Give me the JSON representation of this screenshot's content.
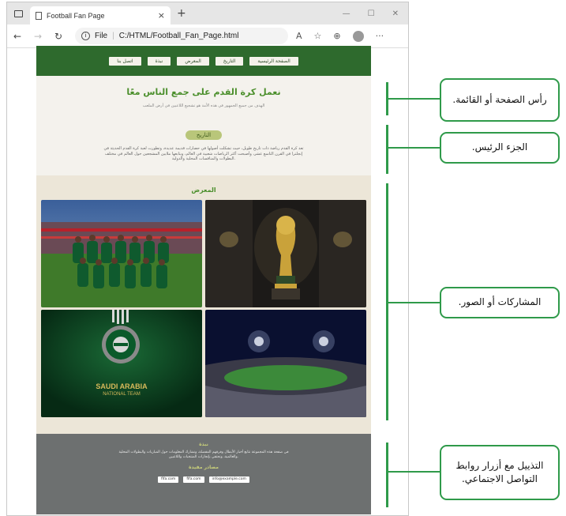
{
  "browser": {
    "tab_title": "Football Fan Page",
    "tab_close": "×",
    "new_tab": "+",
    "controls": {
      "minimize": "—",
      "maximize": "☐",
      "close": "✕"
    },
    "nav": {
      "back": "←",
      "forward": "→",
      "reload": "↻"
    },
    "url_info": "i",
    "url_label": "File",
    "url_sep": "|",
    "url_path": "C:/HTML/Football_Fan_Page.html",
    "toolbar": {
      "read": "A",
      "favorite": "☆",
      "collections": "⊕",
      "menu": "···"
    }
  },
  "page": {
    "nav_buttons": [
      "الصفحة الرئيسية",
      "التاريخ",
      "المعرض",
      "نبذة",
      "اتصل بنا"
    ],
    "title": "نعمل كرة القدم على جمع الناس معًا",
    "subtitle": "الهدف من جميع الجمهور في هذه الأمة هو تشجيع اللاعبين في أرض الملعب",
    "history_button": "التاريخ",
    "history_text": "تعد كرة القدم رياضة ذات تاريخ طويل، حيث تشكلت أصولها في حضارات قديمة عديدة، وتطورت لعبة كرة القدم الحديثة في إنجلترا في القرن التاسع عشر، وأصبحت أكثر الرياضات شعبية في العالم، ويتابعها ملايين المشجعين حول العالم في مختلف البطولات والمنافسات المحلية والدولية.",
    "gallery_title": "المعرض",
    "gallery_badge_line1": "SAUDI ARABIA",
    "gallery_badge_line2": "NATIONAL TEAM",
    "footer_title": "نبذة",
    "footer_text": "في صفحة هذه المجموعة نتابع أخبار الأبطال وفرقهم المفضلة، ونشارك المعلومات حول المباريات والبطولات المحلية والعالمية، ونحتفي بإنجازات المنتخبات واللاعبين.",
    "footer_links_title": "مصادر مفيدة",
    "footer_links": [
      "fifa.com",
      "fifa.com",
      "info@example.com"
    ]
  },
  "annotations": [
    "رأس الصفحة أو القائمة.",
    "الجزء الرئيس.",
    "المشاركات أو الصور.",
    "التذييل مع أزرار روابط التواصل الاجتماعي."
  ],
  "colors": {
    "nav_green": "#2e6a2d",
    "accent_green": "#4b8f2c",
    "annotation_green": "#2f9a4a",
    "footer_gray": "#6d7070",
    "beige": "#ece6d8"
  }
}
